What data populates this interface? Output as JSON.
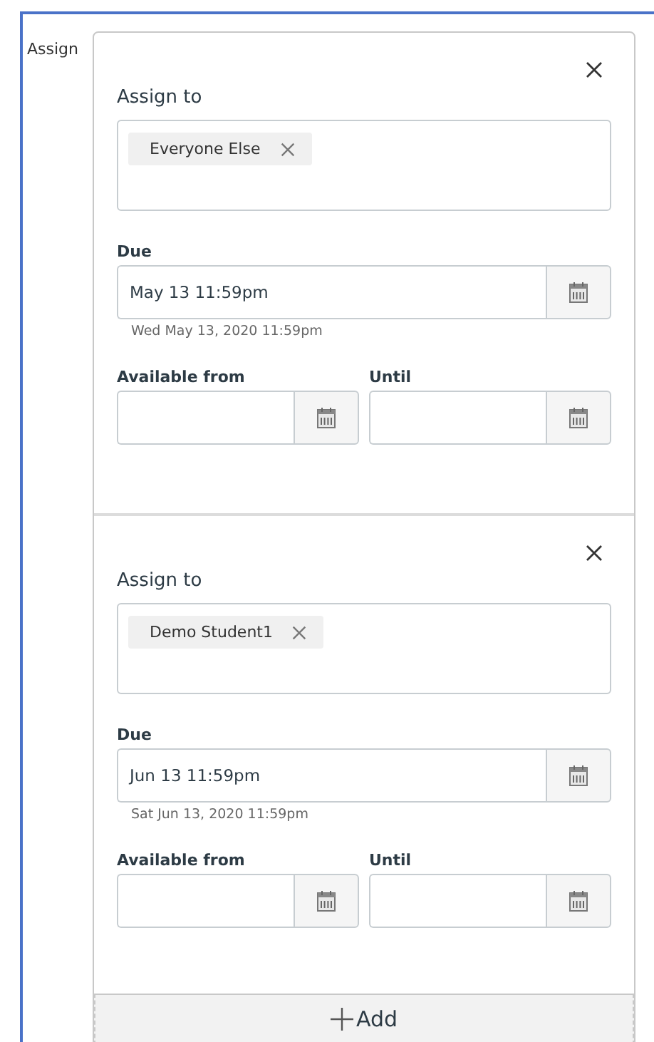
{
  "side_label": "Assign",
  "assignments": [
    {
      "assign_to_label": "Assign to",
      "assignees": [
        "Everyone Else"
      ],
      "due_label": "Due",
      "due_value": "May 13 11:59pm",
      "due_hint": "Wed May 13, 2020 11:59pm",
      "available_from_label": "Available from",
      "until_label": "Until"
    },
    {
      "assign_to_label": "Assign to",
      "assignees": [
        "Demo Student1"
      ],
      "due_label": "Due",
      "due_value": "Jun 13 11:59pm",
      "due_hint": "Sat Jun 13, 2020 11:59pm",
      "available_from_label": "Available from",
      "until_label": "Until"
    }
  ],
  "add_button": "Add"
}
